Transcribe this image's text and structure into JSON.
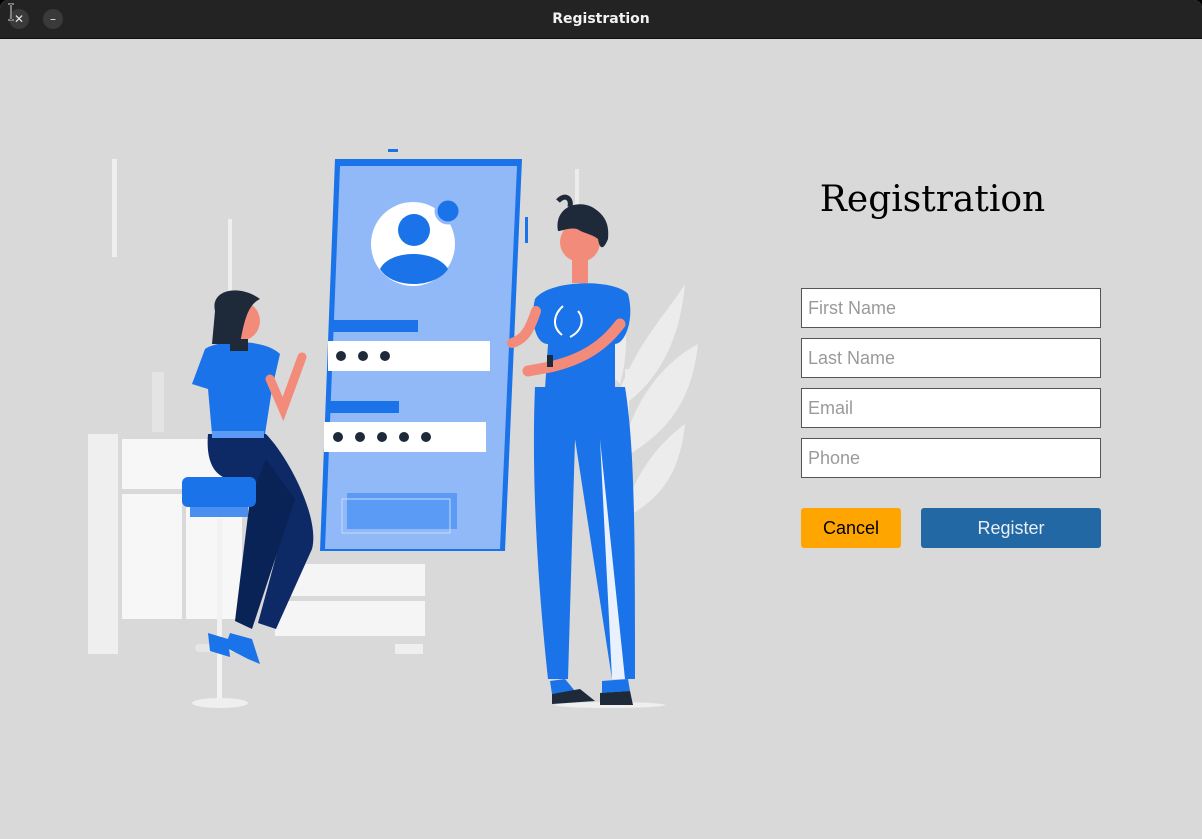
{
  "window": {
    "title": "Registration",
    "close_glyph": "✕",
    "minimize_glyph": "–"
  },
  "form": {
    "heading": "Registration",
    "first_name_placeholder": "First Name",
    "last_name_placeholder": "Last Name",
    "email_placeholder": "Email",
    "phone_placeholder": "Phone",
    "cancel_label": "Cancel",
    "register_label": "Register"
  },
  "colors": {
    "background": "#d9d9d9",
    "cancel_button": "#ffa500",
    "register_button": "#2268a5",
    "illustration_primary": "#1a73e8",
    "illustration_phone": "#91b8f7"
  }
}
